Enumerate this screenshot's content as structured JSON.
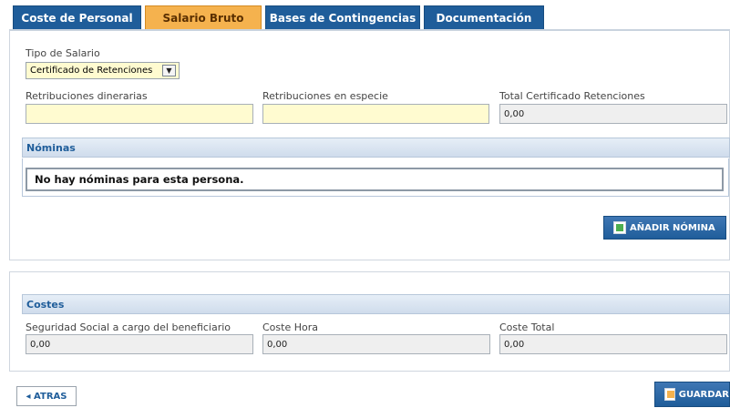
{
  "tabs": [
    {
      "label": "Coste de Personal"
    },
    {
      "label": "Salario Bruto"
    },
    {
      "label": "Bases de Contingencias"
    },
    {
      "label": "Documentación"
    }
  ],
  "salario": {
    "tipo_label": "Tipo de Salario",
    "tipo_value": "Certificado de Retenciones",
    "dinerarias_label": "Retribuciones dinerarias",
    "dinerarias_value": "",
    "especie_label": "Retribuciones en especie",
    "especie_value": "",
    "total_label": "Total Certificado Retenciones",
    "total_value": "0,00"
  },
  "nominas": {
    "title": "Nóminas",
    "empty_message": "No hay nóminas para esta persona.",
    "add_button": "AÑADIR NÓMINA"
  },
  "costes": {
    "title": "Costes",
    "ss_label": "Seguridad Social a cargo del beneficiario",
    "ss_value": "0,00",
    "hora_label": "Coste Hora",
    "hora_value": "0,00",
    "total_label": "Coste Total",
    "total_value": "0,00"
  },
  "footer": {
    "atras": "◂ ATRAS",
    "guardar": "GUARDAR"
  },
  "colors": {
    "tab_blue": "#1f5d9a",
    "tab_active": "#f5b24e",
    "input_yellow": "#fffbd0"
  }
}
